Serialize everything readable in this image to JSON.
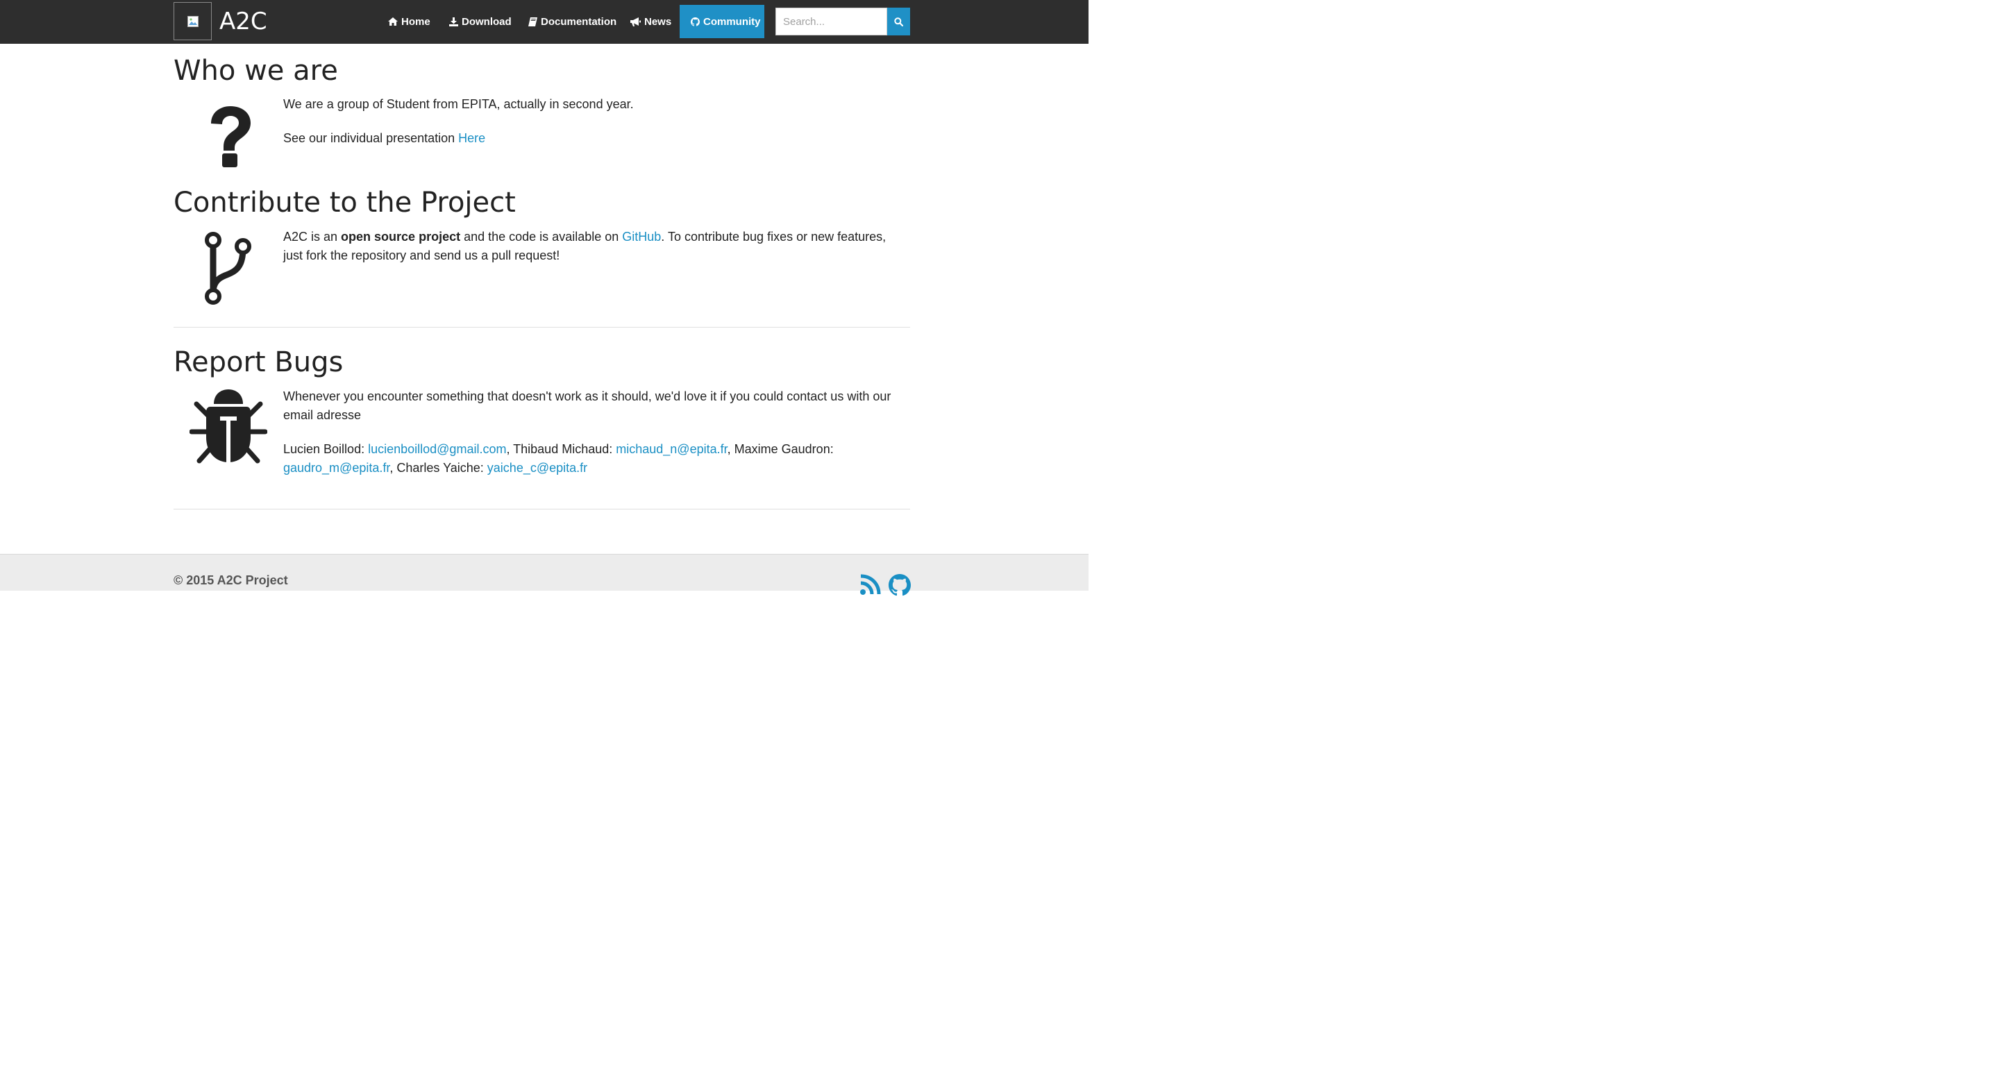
{
  "brand": {
    "title": "A2C",
    "logo_icon": "broken-image-icon"
  },
  "nav": {
    "items": [
      {
        "label": "Home",
        "icon": "home-icon"
      },
      {
        "label": "Download",
        "icon": "download-icon"
      },
      {
        "label": "Documentation",
        "icon": "book-icon"
      },
      {
        "label": "News",
        "icon": "bullhorn-icon"
      },
      {
        "label": "Community",
        "icon": "github-icon",
        "active": true
      }
    ],
    "active_color": "#1f90c6"
  },
  "search": {
    "placeholder": "Search...",
    "value": "",
    "button_icon": "search-icon"
  },
  "sections": {
    "who": {
      "title": "Who we are",
      "icon": "question-mark-icon",
      "line1": "We are a group of Student from EPITA, actually in second year.",
      "line2_prefix": "See our individual presentation ",
      "line2_link": "Here"
    },
    "contribute": {
      "title": "Contribute to the Project",
      "icon": "code-fork-icon",
      "text_before_bold": "A2C is an ",
      "bold": "open source project",
      "text_after_bold": " and the code is available on ",
      "link": "GitHub",
      "text_end": ". To contribute bug fixes or new features, just fork the repository and send us a pull request!"
    },
    "bugs": {
      "title": "Report Bugs",
      "icon": "bug-icon",
      "intro": "Whenever you encounter something that doesn't work as it should, we'd love it if you could contact us with our email adresse",
      "contacts": [
        {
          "name": "Lucien Boillod: ",
          "email": "lucienboillod@gmail.com",
          "sep": ", "
        },
        {
          "name": "Thibaud Michaud: ",
          "email": "michaud_n@epita.fr",
          "sep": ", "
        },
        {
          "name": "Maxime Gaudron: ",
          "email": "gaudro_m@epita.fr",
          "sep": ", "
        },
        {
          "name": "Charles Yaiche: ",
          "email": "yaiche_c@epita.fr",
          "sep": ""
        }
      ]
    }
  },
  "footer": {
    "copyright": "© 2015 A2C Project",
    "icons": [
      "rss-icon",
      "github-icon"
    ]
  },
  "colors": {
    "navbar_bg": "#2e2e2e",
    "link": "#1a8fc4",
    "footer_bg": "#ececec"
  }
}
